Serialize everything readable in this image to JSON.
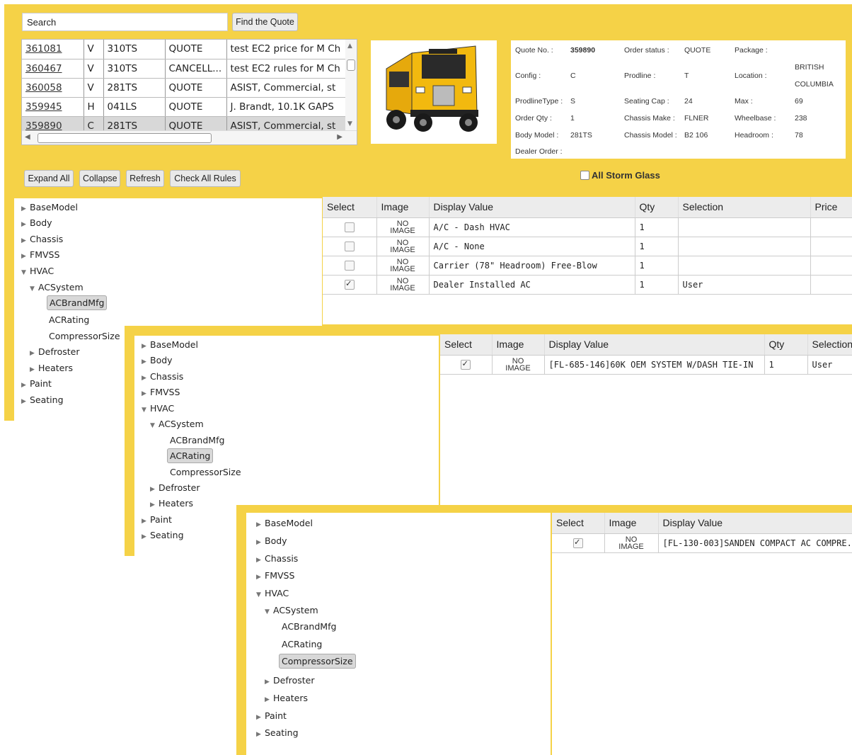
{
  "search": {
    "value": "Search",
    "button": "Find the Quote"
  },
  "quotes": [
    {
      "num": "361081",
      "c": "V",
      "model": "310TS",
      "status": "QUOTE",
      "desc": "test EC2 price for M Ch"
    },
    {
      "num": "360467",
      "c": "V",
      "model": "310TS",
      "status": "CANCELL...",
      "desc": "test EC2 rules for M Ch"
    },
    {
      "num": "360058",
      "c": "V",
      "model": "281TS",
      "status": "QUOTE",
      "desc": "ASIST, Commercial, st"
    },
    {
      "num": "359945",
      "c": "H",
      "model": "041LS",
      "status": "QUOTE",
      "desc": "J. Brandt, 10.1K GAPS"
    },
    {
      "num": "359890",
      "c": "C",
      "model": "281TS",
      "status": "QUOTE",
      "desc": "ASIST, Commercial, st"
    }
  ],
  "info": {
    "quote_no_label": "Quote No. :",
    "quote_no": "359890",
    "order_status_label": "Order status :",
    "order_status": "QUOTE",
    "package_label": "Package :",
    "config_label": "Config :",
    "config": "C",
    "prodline_label": "Prodline :",
    "prodline": "T",
    "location_label": "Location :",
    "location1": "BRITISH",
    "location2": "COLUMBIA",
    "prodline_type_label": "ProdlineType :",
    "prodline_type": "S",
    "seating_label": "Seating Cap :",
    "seating": "24",
    "max_label": "Max :",
    "max": "69",
    "order_qty_label": "Order Qty :",
    "order_qty": "1",
    "chassis_make_label": "Chassis Make :",
    "chassis_make": "FLNER",
    "wheelbase_label": "Wheelbase :",
    "wheelbase": "238",
    "body_model_label": "Body Model :",
    "body_model": "281TS",
    "chassis_model_label": "Chassis Model :",
    "chassis_model": "B2 106",
    "headroom_label": "Headroom :",
    "headroom": "78",
    "dealer_order_label": "Dealer Order :"
  },
  "toolbar": {
    "expand": "Expand All",
    "collapse": "Collapse",
    "refresh": "Refresh",
    "check": "Check All Rules",
    "storm": "All Storm Glass"
  },
  "tree": {
    "base": "BaseModel",
    "body": "Body",
    "chassis": "Chassis",
    "fmvss": "FMVSS",
    "hvac": "HVAC",
    "acsystem": "ACSystem",
    "acbrand": "ACBrandMfg",
    "acrating": "ACRating",
    "compressor": "CompressorSize",
    "defroster": "Defroster",
    "heaters": "Heaters",
    "paint": "Paint",
    "seating": "Seating"
  },
  "grid_headers": {
    "select": "Select",
    "image": "Image",
    "display": "Display Value",
    "qty": "Qty",
    "selection": "Selection",
    "price": "Price"
  },
  "no_image": {
    "line1": "NO",
    "line2": "IMAGE"
  },
  "grid1": [
    {
      "display": "A/C - Dash HVAC",
      "qty": "1",
      "selection": "",
      "checked": false
    },
    {
      "display": "A/C - None",
      "qty": "1",
      "selection": "",
      "checked": false
    },
    {
      "display": "Carrier (78\" Headroom) Free-Blow",
      "qty": "1",
      "selection": "",
      "checked": false
    },
    {
      "display": "Dealer Installed AC",
      "qty": "1",
      "selection": "User",
      "checked": true
    }
  ],
  "grid2": [
    {
      "display": "[FL-685-146]60K OEM SYSTEM W/DASH TIE-IN",
      "qty": "1",
      "selection": "User",
      "checked": true
    }
  ],
  "grid3": [
    {
      "display": "[FL-130-003]SANDEN COMPACT AC COMPRE...",
      "checked": true
    }
  ],
  "colors": {
    "panel": "#f5d247",
    "selected": "#d8d8d8"
  }
}
